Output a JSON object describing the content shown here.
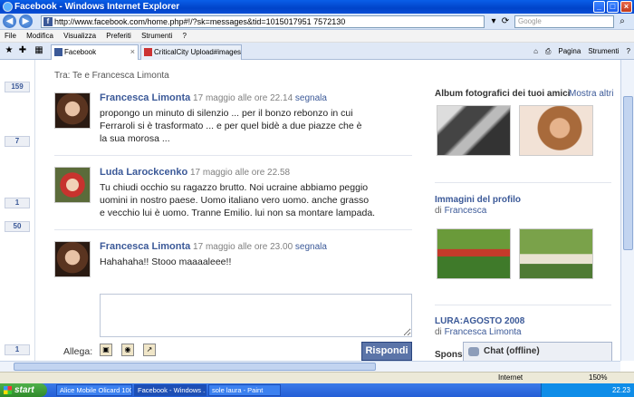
{
  "window": {
    "title": "Facebook - Windows Internet Explorer"
  },
  "browser": {
    "url": "http://www.facebook.com/home.php#!/?sk=messages&tid=1015017951 7572130",
    "search_placeholder": "Google",
    "menu": [
      "File",
      "Modifica",
      "Visualizza",
      "Preferiti",
      "Strumenti",
      "?"
    ],
    "tabs": [
      {
        "label": "Facebook",
        "active": true
      },
      {
        "label": "CriticalCity Upload#images",
        "active": false
      }
    ],
    "page_menu": "Pagina",
    "tools_menu": "Strumenti"
  },
  "left_counts": [
    "159",
    "7",
    "1",
    "50",
    "1"
  ],
  "thread": {
    "header": "Tra: Te e Francesca Limonta",
    "messages": [
      {
        "name": "Francesca Limonta",
        "time": "17 maggio alle ore 22.14",
        "report": "segnala",
        "text": "propongo un minuto di silenzio ... per il bonzo rebonzo in cui Ferraroli si è trasformato ... e per quel bidè a due piazze che è la sua morosa ..."
      },
      {
        "name": "Luda Larockcenko",
        "time": "17 maggio alle ore 22.58",
        "report": "",
        "text": "Tu chiudi occhio su ragazzo brutto. Noi ucraine abbiamo peggio uomini in nostro paese. Uomo italiano vero uomo. anche grasso e vecchio lui è uomo. Tranne Emilio. lui non sa montare lampada."
      },
      {
        "name": "Francesca Limonta",
        "time": "17 maggio alle ore 23.00",
        "report": "segnala",
        "text": "Hahahaha!! Stooo maaaaleee!!"
      }
    ],
    "attach_label": "Allega:",
    "send_label": "Rispondi"
  },
  "sidebar": {
    "friends_albums_title": "Album fotografici dei tuoi amici",
    "show_more": "Mostra altri",
    "profile_images_title": "Immagini del profilo",
    "profile_images_by_prefix": "di",
    "profile_images_by": "Francesca",
    "album_title": "LURA:AGOSTO 2008",
    "album_by_prefix": "di",
    "album_by": "Francesca Limonta",
    "sponsored": "Sponso"
  },
  "chat": {
    "label": "Chat (offline)"
  },
  "statusbar": {
    "zone": "Internet",
    "zoom": "150%"
  },
  "taskbar": {
    "start": "start",
    "tasks": [
      "Alice Mobile Olicard 100",
      "Facebook - Windows ...",
      "sole laura - Paint"
    ],
    "clock": "22.23"
  }
}
